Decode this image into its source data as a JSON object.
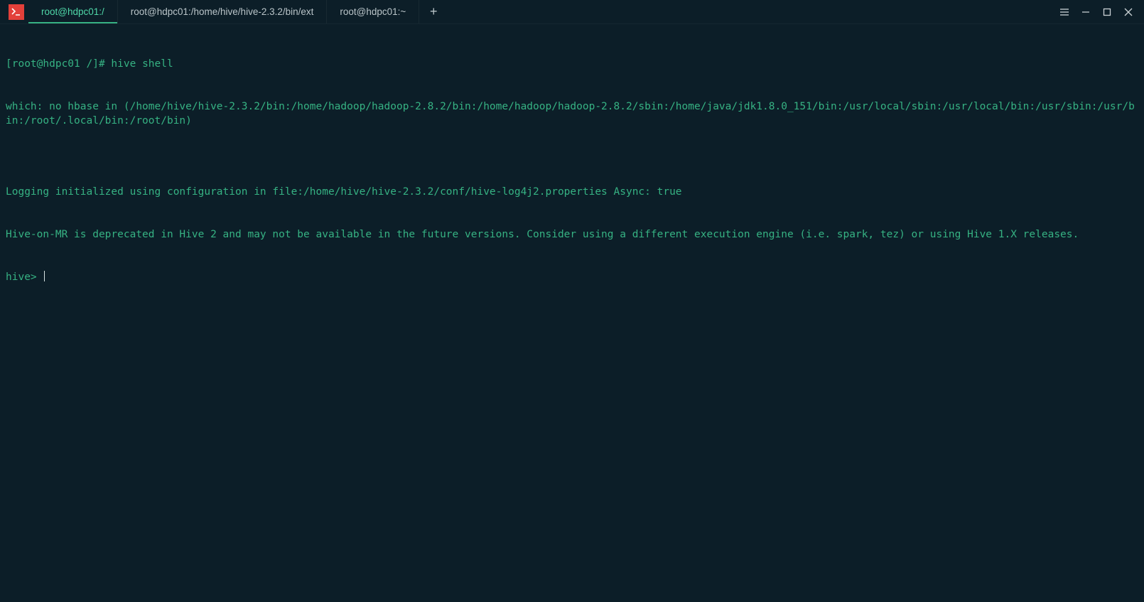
{
  "tabs": [
    {
      "label": "root@hdpc01:/",
      "active": true
    },
    {
      "label": "root@hdpc01:/home/hive/hive-2.3.2/bin/ext",
      "active": false
    },
    {
      "label": "root@hdpc01:~",
      "active": false
    }
  ],
  "terminal": {
    "prompt": "[root@hdpc01 /]#",
    "command": "hive shell",
    "lines": [
      "which: no hbase in (/home/hive/hive-2.3.2/bin:/home/hadoop/hadoop-2.8.2/bin:/home/hadoop/hadoop-2.8.2/sbin:/home/java/jdk1.8.0_151/bin:/usr/local/sbin:/usr/local/bin:/usr/sbin:/usr/bin:/root/.local/bin:/root/bin)",
      "",
      "Logging initialized using configuration in file:/home/hive/hive-2.3.2/conf/hive-log4j2.properties Async: true",
      "Hive-on-MR is deprecated in Hive 2 and may not be available in the future versions. Consider using a different execution engine (i.e. spark, tez) or using Hive 1.X releases."
    ],
    "hive_prompt": "hive>"
  },
  "colors": {
    "bg": "#0c1e28",
    "text": "#36b283",
    "tab_inactive": "#b9c4c8",
    "tab_active": "#4fd7a8",
    "app_icon_bg": "#e3403a"
  }
}
